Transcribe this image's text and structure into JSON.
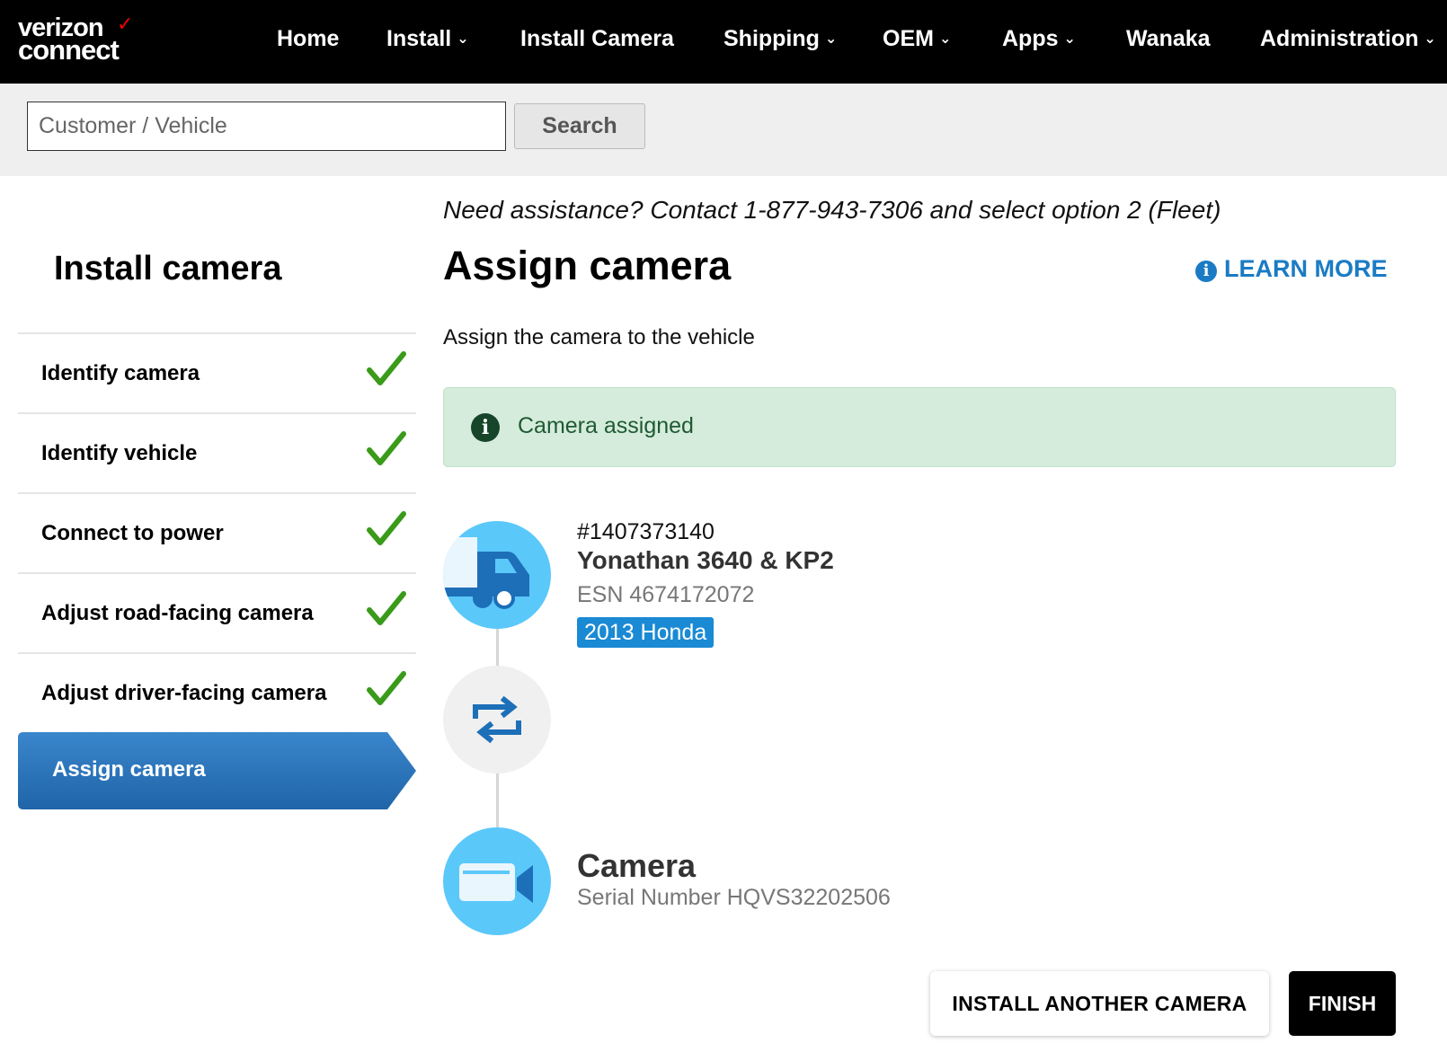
{
  "brand": {
    "logo_line1": "verizon",
    "logo_line2": "connect",
    "accent": "#ee0000"
  },
  "nav": {
    "items": [
      {
        "label": "Home",
        "dropdown": false
      },
      {
        "label": "Install",
        "dropdown": true
      },
      {
        "label": "Install Camera",
        "dropdown": false
      },
      {
        "label": "Shipping",
        "dropdown": true
      },
      {
        "label": "OEM",
        "dropdown": true
      },
      {
        "label": "Apps",
        "dropdown": true
      },
      {
        "label": "Wanaka",
        "dropdown": false
      },
      {
        "label": "Administration",
        "dropdown": true
      }
    ]
  },
  "search": {
    "placeholder": "Customer / Vehicle",
    "value": "",
    "button_label": "Search"
  },
  "sidebar": {
    "title": "Install camera",
    "steps": [
      {
        "label": "Identify camera",
        "done": true
      },
      {
        "label": "Identify vehicle",
        "done": true
      },
      {
        "label": "Connect to power",
        "done": true
      },
      {
        "label": "Adjust road-facing camera",
        "done": true
      },
      {
        "label": "Adjust driver-facing camera",
        "done": true
      }
    ],
    "active_step": "Assign camera",
    "active_color": "#2a73b8"
  },
  "main": {
    "assistance": "Need assistance? Contact 1-877-943-7306 and select option 2 (Fleet)",
    "title": "Assign camera",
    "learn_more": "LEARN MORE",
    "subtitle": "Assign the camera to the vehicle",
    "alert": {
      "text": "Camera assigned",
      "bg": "#d5ecdc"
    },
    "vehicle": {
      "id": "#1407373140",
      "name": "Yonathan 3640 & KP2",
      "esn": "ESN 4674172072",
      "badge": "2013 Honda"
    },
    "camera": {
      "title": "Camera",
      "serial": "Serial Number HQVS32202506"
    },
    "buttons": {
      "install_another": "INSTALL ANOTHER CAMERA",
      "finish": "FINISH"
    }
  }
}
